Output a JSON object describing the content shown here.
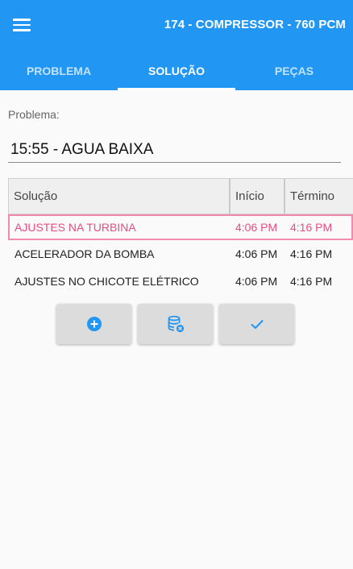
{
  "header": {
    "title": "174 - COMPRESSOR - 760 PCM",
    "menu_icon": "hamburger-menu-icon",
    "background": "#2196f3"
  },
  "tabs": [
    {
      "label": "PROBLEMA",
      "active": false
    },
    {
      "label": "SOLUÇÃO",
      "active": true
    },
    {
      "label": "PEÇAS",
      "active": false
    }
  ],
  "form": {
    "problema_label": "Problema:",
    "problema_value": "15:55 - AGUA BAIXA"
  },
  "table": {
    "columns": [
      "Solução",
      "Início",
      "Término"
    ],
    "rows": [
      {
        "solucao": "AJUSTES NA TURBINA",
        "inicio": "4:06 PM",
        "termino": "4:16 PM",
        "selected": true
      },
      {
        "solucao": "ACELERADOR DA BOMBA",
        "inicio": "4:06 PM",
        "termino": "4:16 PM",
        "selected": false
      },
      {
        "solucao": "AJUSTES NO CHICOTE ELÉTRICO",
        "inicio": "4:06 PM",
        "termino": "4:16 PM",
        "selected": false
      }
    ],
    "selected_color": "#e94c82"
  },
  "actions": {
    "add_icon": "plus-circle-icon",
    "delete_icon": "database-remove-icon",
    "confirm_icon": "checkmark-icon",
    "icon_color": "#2196f3"
  }
}
